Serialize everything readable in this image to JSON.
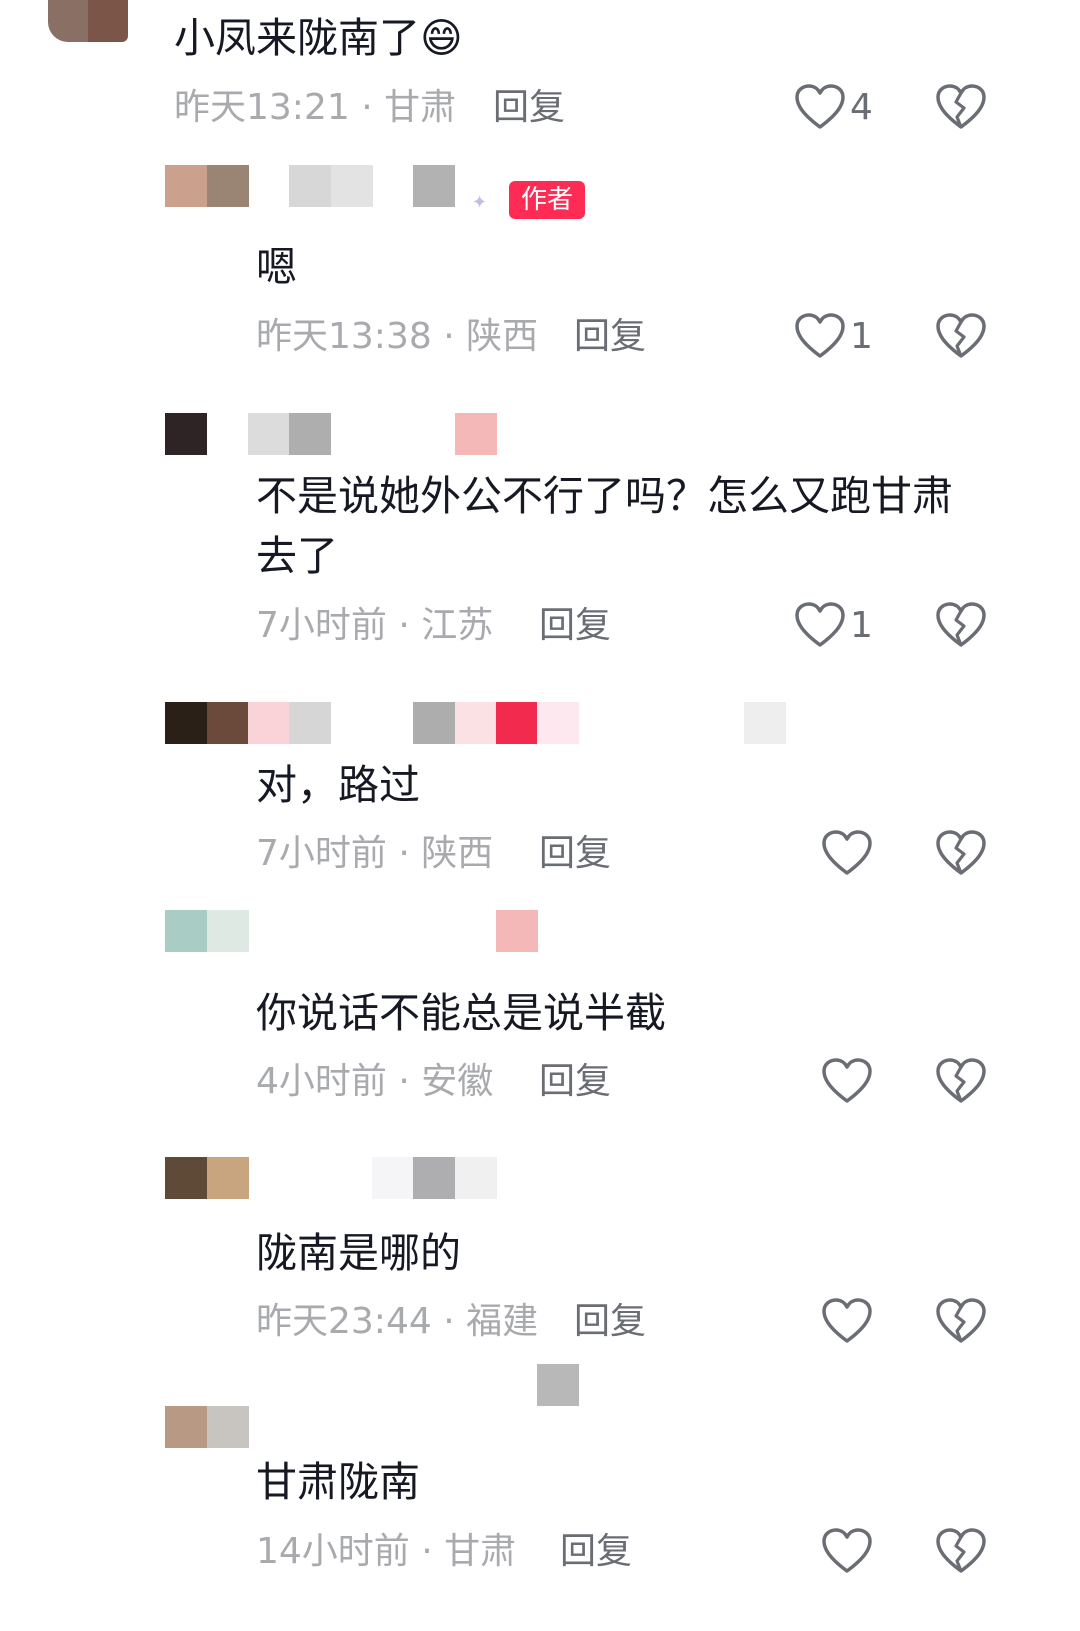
{
  "comments": [
    {
      "text": "小凤来陇南了😄",
      "time": "昨天13:21",
      "location": "甘肃",
      "reply": "回复",
      "likes": "4"
    },
    {
      "badge": "作者",
      "text": "嗯",
      "time": "昨天13:38",
      "location": "陕西",
      "reply": "回复",
      "likes": "1"
    },
    {
      "text": "不是说她外公不行了吗？怎么又跑甘肃",
      "text2": "去了",
      "time": "7小时前",
      "location": "江苏",
      "reply": "回复",
      "likes": "1"
    },
    {
      "text": "对，路过",
      "time": "7小时前",
      "location": "陕西",
      "reply": "回复",
      "likes": ""
    },
    {
      "text": "你说话不能总是说半截",
      "time": "4小时前",
      "location": "安徽",
      "reply": "回复",
      "likes": ""
    },
    {
      "text": "陇南是哪的",
      "time": "昨天23:44",
      "location": "福建",
      "reply": "回复",
      "likes": ""
    },
    {
      "text": "甘肃陇南",
      "time": "14小时前",
      "location": "甘肃",
      "reply": "回复",
      "likes": ""
    }
  ],
  "meta_separator": " · ",
  "colors": {
    "badge": "#fe2c55",
    "text": "#161823",
    "meta": "#a9aaae",
    "icon": "#6b6d74"
  },
  "icons": {
    "like": "heart-outline-icon",
    "dislike": "broken-heart-icon"
  }
}
